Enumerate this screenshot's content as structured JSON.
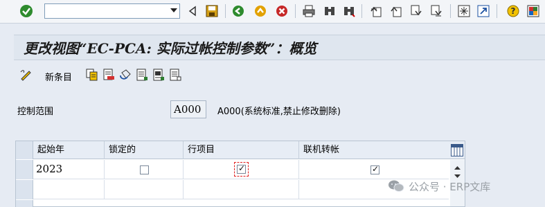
{
  "toolbar": {
    "command_field_value": "",
    "icons": [
      "check-icon",
      "back-icon",
      "save-icon",
      "exit-icon",
      "cancel-icon",
      "print-icon",
      "find-icon",
      "find-next-icon",
      "first-page-icon",
      "previous-page-icon",
      "next-page-icon",
      "last-page-icon",
      "new-session-icon",
      "shortcut-icon",
      "help-icon",
      "layout-icon"
    ]
  },
  "title": "更改视图“EC-PCA: 实际过帐控制参数”：概览",
  "app_toolbar": {
    "new_entries_label": "新条目"
  },
  "control_area": {
    "label": "控制范围",
    "value": "A000",
    "description": "A000(系统标准,禁止修改删除)"
  },
  "table": {
    "columns": [
      "起始年",
      "锁定的",
      "行项目",
      "联机转帐"
    ],
    "rows": [
      {
        "start_year": "2023",
        "locked": false,
        "line_items": true,
        "online_transfer": true
      },
      {
        "start_year": "",
        "locked": null,
        "line_items": null,
        "online_transfer": null
      },
      {
        "start_year": "",
        "locked": null,
        "line_items": null,
        "online_transfer": null
      }
    ]
  },
  "watermark": {
    "text": "公众号 · ERP文库"
  },
  "colors": {
    "background": "#e6ebf3",
    "title_bar": "#dfe6ef",
    "focus": "#e02020",
    "ok_green": "#2e8b2e"
  }
}
